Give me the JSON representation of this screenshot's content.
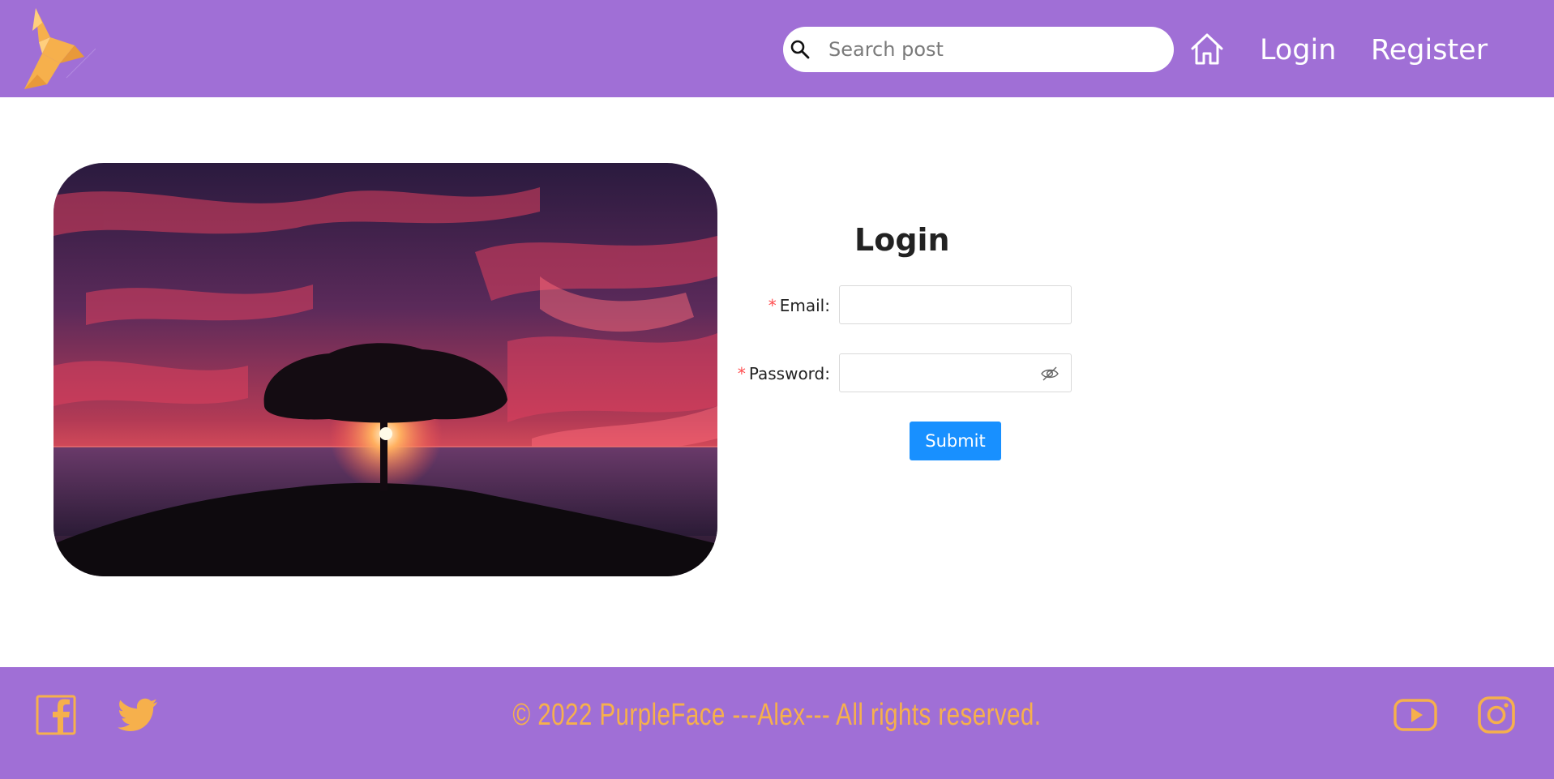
{
  "header": {
    "search": {
      "placeholder": "Search post",
      "value": ""
    },
    "nav": {
      "login": "Login",
      "register": "Register"
    }
  },
  "form": {
    "title": "Login",
    "email": {
      "label": "Email",
      "required_mark": "*",
      "value": ""
    },
    "password": {
      "label": "Password",
      "required_mark": "*",
      "value": ""
    },
    "submit_label": "Submit"
  },
  "footer": {
    "copyright": "© 2022 PurpleFace ---Alex--- All rights reserved."
  },
  "colors": {
    "brand_purple": "#a06fd6",
    "accent_orange": "#f6b04c",
    "primary_button": "#1890ff",
    "required_red": "#ff4d4f"
  },
  "icons": {
    "logo": "origami-bird-logo",
    "search": "search-icon",
    "home": "home-icon",
    "password_visibility": "eye-invisible-icon",
    "social": [
      "facebook-icon",
      "twitter-icon",
      "youtube-icon",
      "instagram-icon"
    ]
  }
}
